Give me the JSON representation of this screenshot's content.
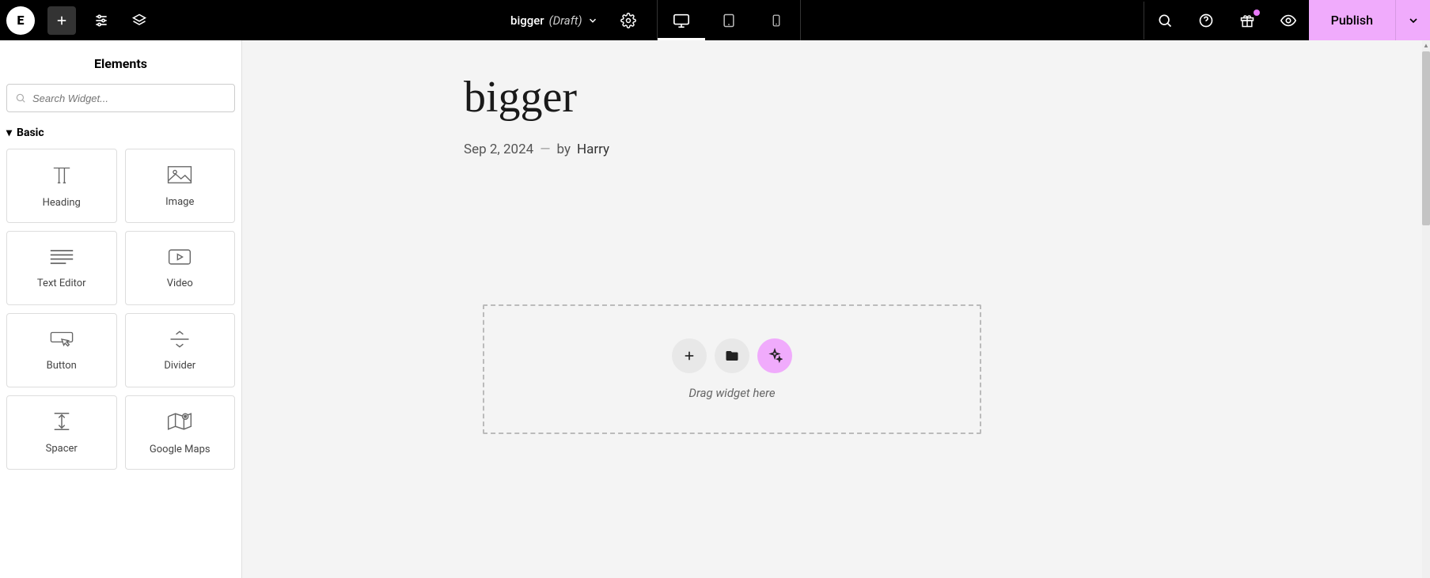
{
  "topbar": {
    "logo_text": "E",
    "doc_name": "bigger",
    "doc_status": "(Draft)",
    "publish_label": "Publish"
  },
  "sidebar": {
    "title": "Elements",
    "search_placeholder": "Search Widget...",
    "category": "Basic",
    "widgets": [
      {
        "label": "Heading"
      },
      {
        "label": "Image"
      },
      {
        "label": "Text Editor"
      },
      {
        "label": "Video"
      },
      {
        "label": "Button"
      },
      {
        "label": "Divider"
      },
      {
        "label": "Spacer"
      },
      {
        "label": "Google Maps"
      }
    ]
  },
  "page": {
    "title": "bigger",
    "date": "Sep 2, 2024",
    "separator": "—",
    "by_label": "by",
    "author": "Harry"
  },
  "dropzone": {
    "hint": "Drag widget here"
  }
}
